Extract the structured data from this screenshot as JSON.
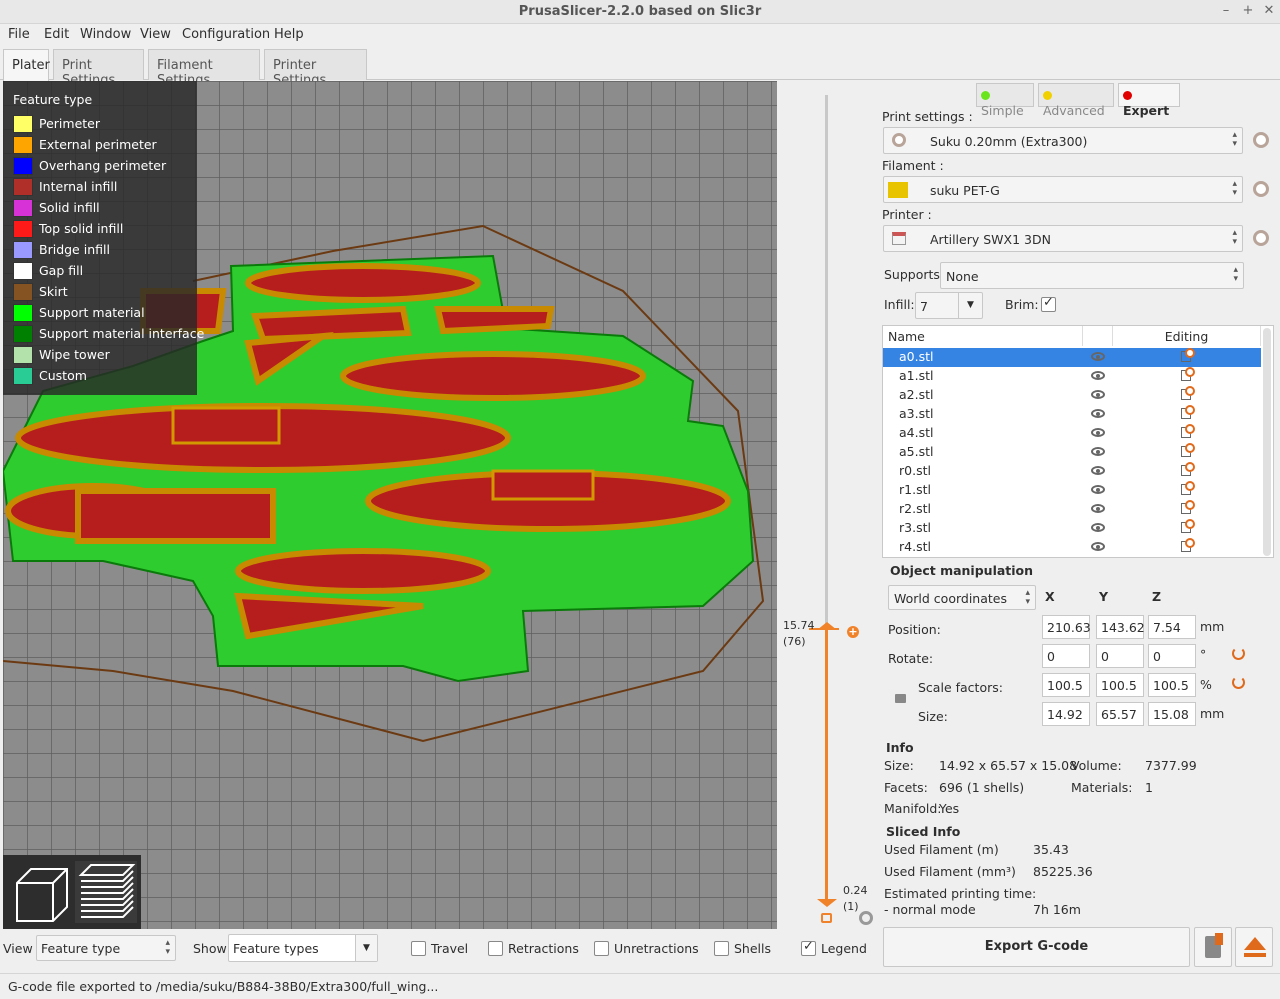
{
  "window": {
    "title": "PrusaSlicer-2.2.0 based on Slic3r"
  },
  "menu": [
    "File",
    "Edit",
    "Window",
    "View",
    "Configuration",
    "Help"
  ],
  "tabs": [
    "Plater",
    "Print Settings",
    "Filament Settings",
    "Printer Settings"
  ],
  "legend": {
    "title": "Feature type",
    "items": [
      {
        "label": "Perimeter",
        "color": "#ffff66"
      },
      {
        "label": "External perimeter",
        "color": "#ffa500"
      },
      {
        "label": "Overhang perimeter",
        "color": "#0000ff"
      },
      {
        "label": "Internal infill",
        "color": "#b03029"
      },
      {
        "label": "Solid infill",
        "color": "#d732d7"
      },
      {
        "label": "Top solid infill",
        "color": "#ff1a1a"
      },
      {
        "label": "Bridge infill",
        "color": "#9999ff"
      },
      {
        "label": "Gap fill",
        "color": "#ffffff"
      },
      {
        "label": "Skirt",
        "color": "#845321"
      },
      {
        "label": "Support material",
        "color": "#00ff00"
      },
      {
        "label": "Support material interface",
        "color": "#008000"
      },
      {
        "label": "Wipe tower",
        "color": "#b3e3ab"
      },
      {
        "label": "Custom",
        "color": "#28cc94"
      }
    ]
  },
  "layer_slider": {
    "top_height": "15.74",
    "top_layer": "(76)",
    "bottom_height": "0.24",
    "bottom_layer": "(1)"
  },
  "mode": {
    "simple": "Simple",
    "advanced": "Advanced",
    "expert": "Expert"
  },
  "print_settings": {
    "label": "Print settings :",
    "value": "Suku 0.20mm (Extra300)"
  },
  "filament": {
    "label": "Filament :",
    "value": "suku PET-G",
    "color": "#e8c400"
  },
  "printer": {
    "label": "Printer :",
    "value": "Artillery SWX1 3DN"
  },
  "supports": {
    "label": "Supports:",
    "value": "None"
  },
  "infill": {
    "label": "Infill:",
    "value": "7"
  },
  "brim": {
    "label": "Brim:",
    "checked": true
  },
  "objects": {
    "col_name": "Name",
    "col_editing": "Editing",
    "items": [
      "a0.stl",
      "a1.stl",
      "a2.stl",
      "a3.stl",
      "a4.stl",
      "a5.stl",
      "r0.stl",
      "r1.stl",
      "r2.stl",
      "r3.stl",
      "r4.stl"
    ]
  },
  "object_manipulation": {
    "title": "Object manipulation",
    "coords": "World coordinates",
    "x": "X",
    "y": "Y",
    "z": "Z",
    "position_label": "Position:",
    "position": [
      "210.63",
      "143.62",
      "7.54"
    ],
    "position_unit": "mm",
    "rotate_label": "Rotate:",
    "rotate": [
      "0",
      "0",
      "0"
    ],
    "rotate_unit": "°",
    "scale_label": "Scale factors:",
    "scale": [
      "100.5",
      "100.5",
      "100.5"
    ],
    "scale_unit": "%",
    "size_label": "Size:",
    "size": [
      "14.92",
      "65.57",
      "15.08"
    ],
    "size_unit": "mm"
  },
  "info": {
    "title": "Info",
    "size_label": "Size:",
    "size": "14.92 x 65.57 x 15.08",
    "volume_label": "Volume:",
    "volume": "7377.99",
    "facets_label": "Facets:",
    "facets": "696 (1 shells)",
    "materials_label": "Materials:",
    "materials": "1",
    "manifold_label": "Manifold:",
    "manifold": "Yes"
  },
  "sliced_info": {
    "title": "Sliced Info",
    "used_m_label": "Used Filament (m)",
    "used_m": "35.43",
    "used_mm3_label": "Used Filament (mm³)",
    "used_mm3": "85225.36",
    "est_label": "Estimated printing time:",
    "normal_label": "- normal mode",
    "normal": "7h 16m"
  },
  "export_button": "Export G-code",
  "bottom": {
    "view_label": "View",
    "view_value": "Feature type",
    "show_label": "Show",
    "show_value": "Feature types",
    "travel": "Travel",
    "retractions": "Retractions",
    "unretractions": "Unretractions",
    "shells": "Shells",
    "legend": "Legend"
  },
  "status": "G-code file exported to /media/suku/B884-38B0/Extra300/full_wing..."
}
